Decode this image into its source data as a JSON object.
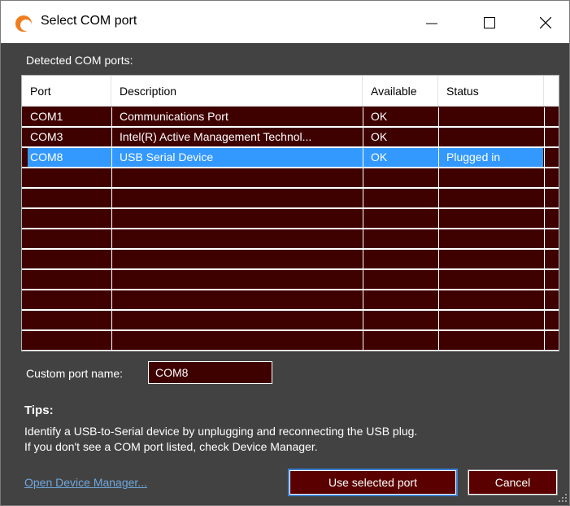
{
  "window": {
    "title": "Select COM port",
    "icon": "app-logo-icon",
    "controls": [
      "minimize-icon",
      "maximize-icon",
      "close-icon"
    ]
  },
  "list": {
    "label": "Detected COM ports:",
    "columns": [
      "Port",
      "Description",
      "Available",
      "Status"
    ],
    "rows": [
      {
        "port": "COM1",
        "description": "Communications Port",
        "available": "OK",
        "status": ""
      },
      {
        "port": "COM3",
        "description": "Intel(R) Active Management Technol...",
        "available": "OK",
        "status": ""
      },
      {
        "port": "COM8",
        "description": "USB Serial Device",
        "available": "OK",
        "status": "Plugged in",
        "selected": true
      }
    ]
  },
  "custom_port": {
    "label": "Custom port name:",
    "value": "COM8"
  },
  "tips": {
    "title": "Tips:",
    "line1": "Identify a USB-to-Serial device by unplugging and reconnecting the USB plug.",
    "line2": "If you don't see a COM port listed, check Device Manager."
  },
  "footer": {
    "link": "Open Device Manager...",
    "primary_button": "Use selected port",
    "cancel_button": "Cancel"
  },
  "colors": {
    "background": "#424242",
    "list_background": "#3f0000",
    "selection": "#3399ff",
    "button": "#5a0000",
    "link": "#6fa8dc",
    "accent_icon": "#f07c1e"
  }
}
